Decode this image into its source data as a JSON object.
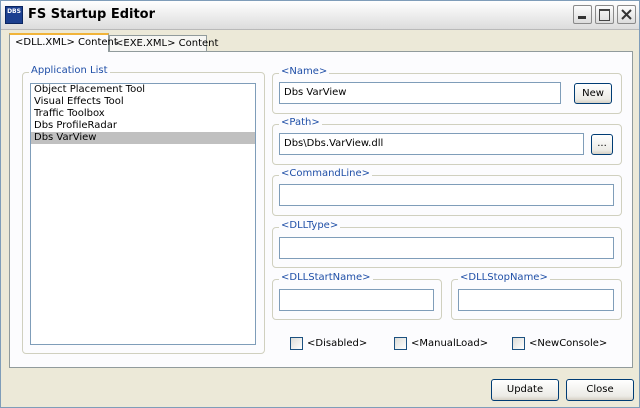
{
  "window": {
    "title": "FS Startup Editor",
    "icon_text": "DBS"
  },
  "tabs": [
    {
      "label": "<DLL.XML> Content",
      "active": true
    },
    {
      "label": "<EXE.XML> Content",
      "active": false
    }
  ],
  "application_list": {
    "label": "Application List",
    "items": [
      "Object Placement Tool",
      "Visual Effects Tool",
      "Traffic Toolbox",
      "Dbs ProfileRadar",
      "Dbs VarView"
    ],
    "selected_index": 4
  },
  "name": {
    "label": "<Name>",
    "value": "Dbs VarView",
    "new_button": "New"
  },
  "path": {
    "label": "<Path>",
    "value": "Dbs\\Dbs.VarView.dll",
    "browse_button": "..."
  },
  "commandline": {
    "label": "<CommandLine>",
    "value": ""
  },
  "dlltype": {
    "label": "<DLLType>",
    "value": ""
  },
  "dllstartname": {
    "label": "<DLLStartName>",
    "value": ""
  },
  "dllstopname": {
    "label": "<DLLStopName>",
    "value": ""
  },
  "options": {
    "disabled": {
      "label": "<Disabled>",
      "checked": false
    },
    "manualload": {
      "label": "<ManualLoad>",
      "checked": false
    },
    "newconsole": {
      "label": "<NewConsole>",
      "checked": false
    }
  },
  "footer": {
    "update_label": "Update",
    "close_label": "Close"
  },
  "colors": {
    "group_label": "#1f4fa7",
    "active_tab_accent": "#f1b43a",
    "selection": "#c0c0c0"
  }
}
